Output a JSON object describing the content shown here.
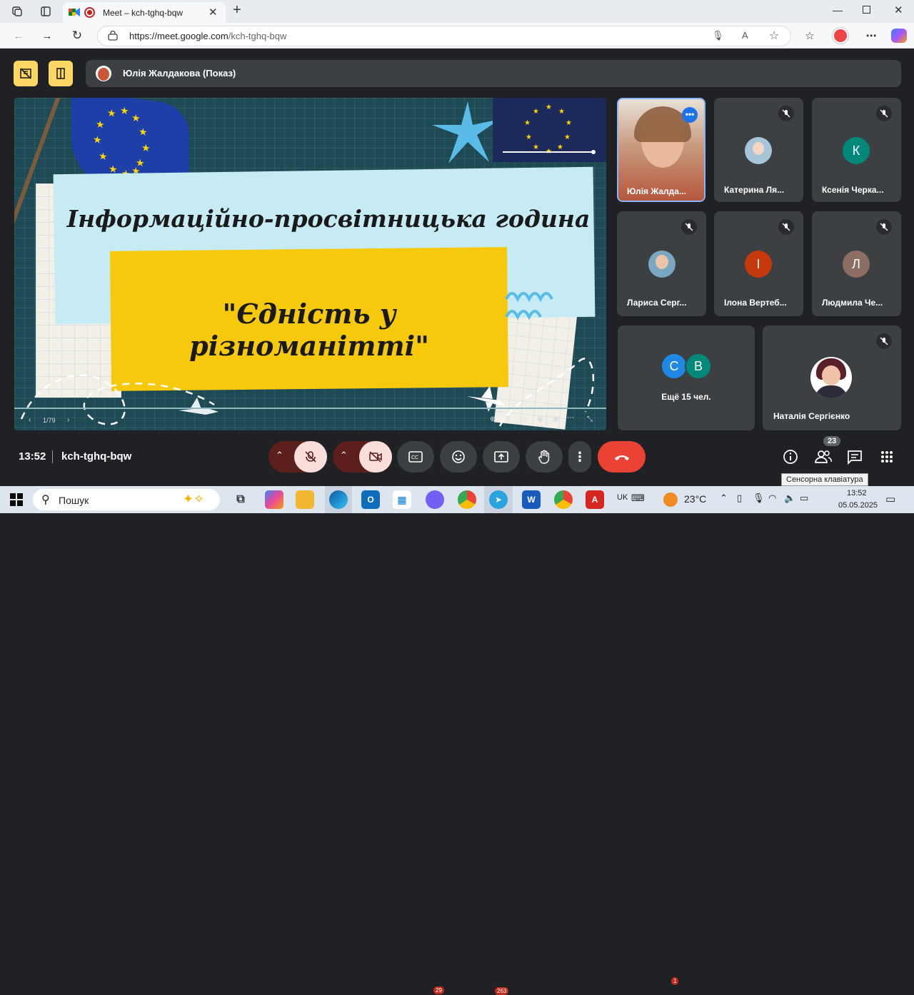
{
  "browser": {
    "tab_title": "Meet – kch-tghq-bqw",
    "new_tab_symbol": "+",
    "url_host": "https://meet.google.com",
    "url_path": "/kch-tghq-bqw"
  },
  "meet": {
    "presenter_label": "Юлія Жалдакова (Показ)",
    "slide": {
      "title_line": "Інформаційно-просвітницька година",
      "subtitle_line": "\"Єдність у різноманітті\"",
      "page_indicator": "1/79"
    },
    "participants": [
      {
        "name": "Юлія Жалда...",
        "muted": false
      },
      {
        "name": "Катерина Ля...",
        "muted": true
      },
      {
        "name": "Ксенія Черка...",
        "muted": true,
        "initial": "К",
        "color": "#00897b"
      },
      {
        "name": "Лариса Серг...",
        "muted": true
      },
      {
        "name": "Ілона Вертеб...",
        "muted": true,
        "initial": "І",
        "color": "#c5390c"
      },
      {
        "name": "Людмила Че...",
        "muted": true,
        "initial": "Л",
        "color": "#8d6e63"
      },
      {
        "name": "Наталія Сергієнко",
        "muted": true
      }
    ],
    "others": {
      "label": "Ещё 15 чел.",
      "initials": [
        "С",
        "В"
      ],
      "colors": [
        "#1e88e5",
        "#00897b"
      ]
    },
    "footer": {
      "time": "13:52",
      "meeting_code": "kch-tghq-bqw",
      "people_count": "23",
      "tooltip": "Сенсорна клавіатура"
    },
    "colors": {
      "accent_yellow": "#fdd663",
      "end_call": "#ea4335",
      "muted_red": "#f9dedc"
    }
  },
  "taskbar": {
    "search_label": "Пошук",
    "viber_badge": "29",
    "telegram_badge": "263",
    "weather_badge": "1",
    "language": "UK",
    "temperature": "23°C",
    "clock_time": "13:52",
    "clock_date": "05.05.2025"
  }
}
